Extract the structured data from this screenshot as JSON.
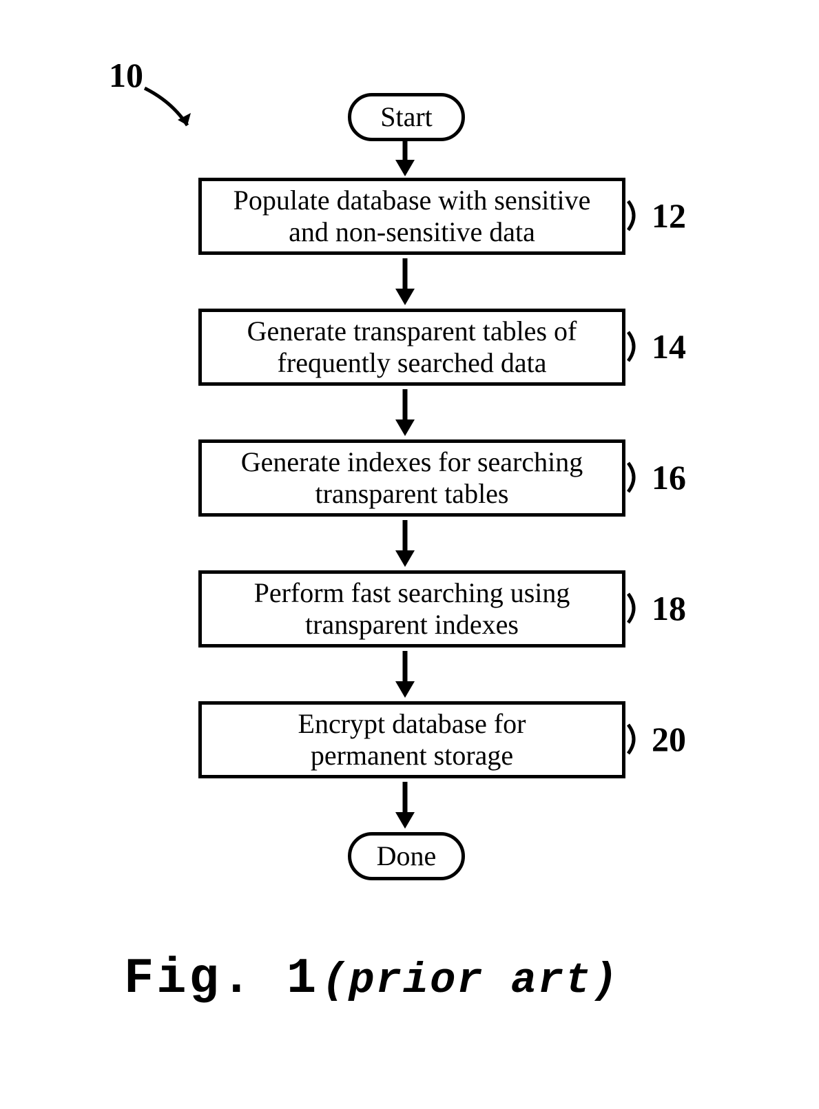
{
  "figure": {
    "reference_label": "10",
    "terminator_start": "Start",
    "terminator_done": "Done",
    "steps": [
      {
        "ref": "12",
        "text": "Populate database with sensitive\nand non-sensitive data"
      },
      {
        "ref": "14",
        "text": "Generate transparent tables of\nfrequently searched data"
      },
      {
        "ref": "16",
        "text": "Generate indexes for searching\ntransparent tables"
      },
      {
        "ref": "18",
        "text": "Perform fast searching using\ntransparent indexes"
      },
      {
        "ref": "20",
        "text": "Encrypt database for\npermanent storage"
      }
    ],
    "caption_bold": "Fig. 1",
    "caption_italic": "(prior art)"
  }
}
